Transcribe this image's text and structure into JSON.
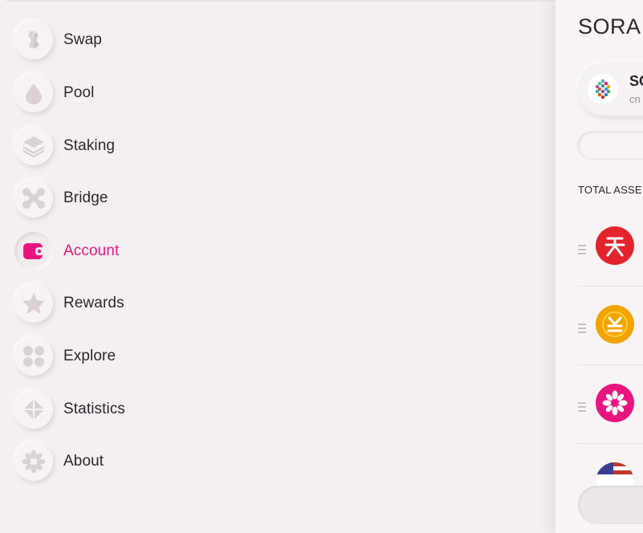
{
  "sidebar": {
    "items": [
      {
        "label": "Swap",
        "icon": "swap-icon"
      },
      {
        "label": "Pool",
        "icon": "drop-icon"
      },
      {
        "label": "Staking",
        "icon": "layers-icon"
      },
      {
        "label": "Bridge",
        "icon": "bridge-icon"
      },
      {
        "label": "Account",
        "icon": "wallet-icon",
        "active": true
      },
      {
        "label": "Rewards",
        "icon": "star-icon"
      },
      {
        "label": "Explore",
        "icon": "grid-icon"
      },
      {
        "label": "Statistics",
        "icon": "diamond-icon"
      },
      {
        "label": "About",
        "icon": "flower-icon"
      }
    ]
  },
  "panel": {
    "title": "SORA",
    "account": {
      "name": "SO",
      "address": "cn"
    },
    "total_assets_label": "TOTAL ASSE",
    "assets": [
      {
        "icon": "tianjin-asset-icon",
        "color": "#e4242c"
      },
      {
        "icon": "yen-asset-icon",
        "color": "#f2a400"
      },
      {
        "icon": "sora-flower-asset-icon",
        "color": "#e8157f"
      },
      {
        "icon": "usd-asset-icon",
        "color": "#3a3f8f"
      }
    ]
  },
  "colors": {
    "accent": "#e8157f",
    "background": "#f4eff0",
    "text": "#2d2630",
    "icon_gray": "#d9d1d4"
  }
}
